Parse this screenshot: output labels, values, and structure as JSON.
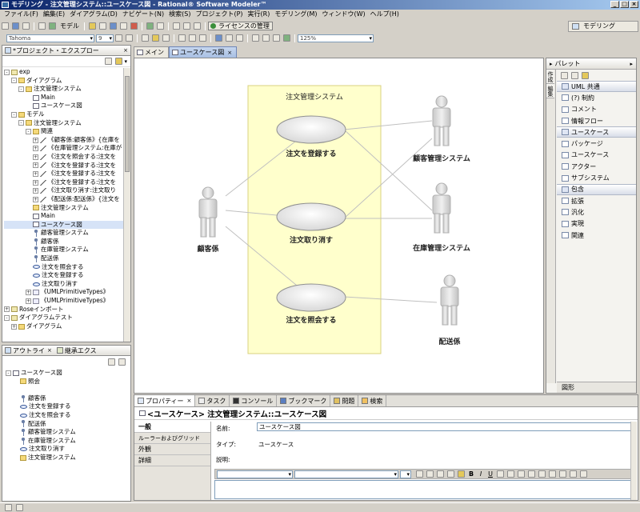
{
  "window": {
    "title": "モデリング - 注文管理システム::ユースケース図 - Rational® Software Modeler™"
  },
  "menu": [
    "ファイル(F)",
    "編集(E)",
    "ダイアグラム(D)",
    "ナビゲート(N)",
    "検索(S)",
    "プロジェクト(P)",
    "実行(R)",
    "モデリング(M)",
    "ウィンドウ(W)",
    "ヘルプ(H)"
  ],
  "toolbar": {
    "modeling_label": "モデル",
    "license_button": "ライセンスの管理",
    "font_combo": "Tahoma",
    "font_size": "9",
    "zoom": "125%",
    "perspective": "モデリング"
  },
  "project_explorer": {
    "title": "*プロジェクト・エクスプロー",
    "items": [
      {
        "d": 0,
        "t": "-",
        "i": "pkg",
        "l": "exp"
      },
      {
        "d": 1,
        "t": "-",
        "i": "folder",
        "l": "ダイアグラム"
      },
      {
        "d": 2,
        "t": "-",
        "i": "folder",
        "l": "注文管理システム"
      },
      {
        "d": 3,
        "t": "",
        "i": "diag",
        "l": "Main"
      },
      {
        "d": 3,
        "t": "",
        "i": "diag",
        "l": "ユースケース図"
      },
      {
        "d": 1,
        "t": "-",
        "i": "folder",
        "l": "モデル"
      },
      {
        "d": 2,
        "t": "-",
        "i": "folder",
        "l": "注文管理システム"
      },
      {
        "d": 3,
        "t": "-",
        "i": "folder",
        "l": "関連"
      },
      {
        "d": 4,
        "t": "+",
        "i": "assoc",
        "l": "《顧客係:顧客係》{在庫を"
      },
      {
        "d": 4,
        "t": "+",
        "i": "assoc",
        "l": "《在庫管理システム:在庫が"
      },
      {
        "d": 4,
        "t": "+",
        "i": "assoc",
        "l": "《注文を照会する:注文を"
      },
      {
        "d": 4,
        "t": "+",
        "i": "assoc",
        "l": "《注文を登録する:注文を"
      },
      {
        "d": 4,
        "t": "+",
        "i": "assoc",
        "l": "《注文を登録する:注文を"
      },
      {
        "d": 4,
        "t": "+",
        "i": "assoc",
        "l": "《注文を登録する:注文を"
      },
      {
        "d": 4,
        "t": "+",
        "i": "assoc",
        "l": "《注文取り消す:注文取り"
      },
      {
        "d": 4,
        "t": "+",
        "i": "assoc",
        "l": "《配送係:配送係》{注文を"
      },
      {
        "d": 3,
        "t": "",
        "i": "folder",
        "l": "注文管理システム"
      },
      {
        "d": 3,
        "t": "",
        "i": "diag",
        "l": "Main"
      },
      {
        "d": 3,
        "t": "",
        "i": "diag",
        "l": "ユースケース図",
        "sel": true
      },
      {
        "d": 3,
        "t": "",
        "i": "actor",
        "l": "顧客管理システム"
      },
      {
        "d": 3,
        "t": "",
        "i": "actor",
        "l": "顧客係"
      },
      {
        "d": 3,
        "t": "",
        "i": "actor",
        "l": "在庫管理システム"
      },
      {
        "d": 3,
        "t": "",
        "i": "actor",
        "l": "配送係"
      },
      {
        "d": 3,
        "t": "",
        "i": "uc",
        "l": "注文を照会する"
      },
      {
        "d": 3,
        "t": "",
        "i": "uc",
        "l": "注文を登録する"
      },
      {
        "d": 3,
        "t": "",
        "i": "uc",
        "l": "注文取り消す"
      },
      {
        "d": 3,
        "t": "+",
        "i": "rel",
        "l": "《UMLPrimitiveTypes》"
      },
      {
        "d": 3,
        "t": "+",
        "i": "rel",
        "l": "《UMLPrimitiveTypes》"
      },
      {
        "d": 0,
        "t": "+",
        "i": "pkg",
        "l": "Roseインポート"
      },
      {
        "d": 0,
        "t": "-",
        "i": "pkg",
        "l": "ダイアグラムテスト"
      },
      {
        "d": 1,
        "t": "+",
        "i": "folder",
        "l": "ダイアグラム"
      }
    ]
  },
  "outline": {
    "tab1": "アウトライ",
    "tab2": "継承エクス",
    "items": [
      {
        "d": 0,
        "t": "-",
        "i": "diag",
        "l": "ユースケース図"
      },
      {
        "d": 1,
        "t": "",
        "i": "folder",
        "l": "照会"
      },
      {
        "d": 1,
        "t": "",
        "i": "",
        "l": ""
      },
      {
        "d": 1,
        "t": "",
        "i": "actor",
        "l": "顧客係"
      },
      {
        "d": 1,
        "t": "",
        "i": "uc",
        "l": "注文を登録する"
      },
      {
        "d": 1,
        "t": "",
        "i": "uc",
        "l": "注文を照会する"
      },
      {
        "d": 1,
        "t": "",
        "i": "actor",
        "l": "配送係"
      },
      {
        "d": 1,
        "t": "",
        "i": "actor",
        "l": "顧客管理システム"
      },
      {
        "d": 1,
        "t": "",
        "i": "actor",
        "l": "在庫管理システム"
      },
      {
        "d": 1,
        "t": "",
        "i": "uc",
        "l": "注文取り消す"
      },
      {
        "d": 1,
        "t": "",
        "i": "folder",
        "l": "注文管理システム"
      }
    ]
  },
  "editor": {
    "tabs": [
      "メイン",
      "ユースケース図"
    ],
    "system_title": "注文管理システム",
    "use_cases": [
      "注文を登録する",
      "注文取り消す",
      "注文を照会する"
    ],
    "actors": [
      "顧客係",
      "顧客管理システム",
      "在庫管理システム",
      "配送係"
    ]
  },
  "palette": {
    "title": "パレット",
    "vtabs": [
      "作成",
      "編集"
    ],
    "items": [
      {
        "l": "UML 共通",
        "hdr": true
      },
      {
        "l": "(?) 制約"
      },
      {
        "l": "コメント"
      },
      {
        "l": "情報フロー"
      },
      {
        "l": "ユースケース",
        "hdr": true
      },
      {
        "l": "パッケージ"
      },
      {
        "l": "ユースケース"
      },
      {
        "l": "アクター"
      },
      {
        "l": "サブシステム"
      },
      {
        "l": "包含",
        "hdr": true
      },
      {
        "l": "拡張"
      },
      {
        "l": "汎化"
      },
      {
        "l": "実現"
      },
      {
        "l": "関連"
      }
    ],
    "footer": "図形"
  },
  "bottom": {
    "tabs": [
      "プロパティー",
      "タスク",
      "コンソール",
      "ブックマーク",
      "問題",
      "検索"
    ],
    "header": "<ユースケース> 注文管理システム::ユースケース図",
    "side": [
      "一般",
      "ルーラーおよびグリッド",
      "外観",
      "詳細"
    ],
    "name_label": "名前:",
    "name_value": "ユースケース図",
    "type_label": "タイプ:",
    "type_value": "ユースケース",
    "desc_label": "説明:"
  }
}
